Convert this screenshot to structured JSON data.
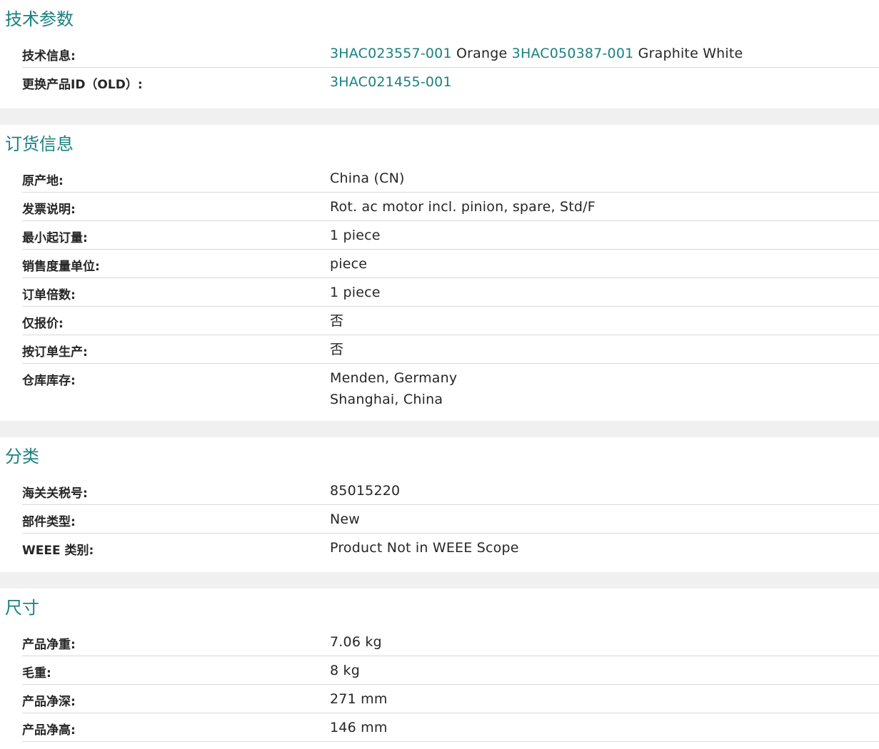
{
  "tech": {
    "title": "技术参数",
    "tech_info_label": "技术信息:",
    "tech_info": [
      {
        "text": "3HAC023557-001",
        "link": true
      },
      {
        "text": " Orange ",
        "link": false
      },
      {
        "text": "3HAC050387-001",
        "link": true
      },
      {
        "text": " Graphite White",
        "link": false
      }
    ],
    "replace_label": "更换产品ID（OLD）:",
    "replace_value": "3HAC021455-001"
  },
  "order": {
    "title": "订货信息",
    "rows": [
      {
        "label": "原产地:",
        "value": "China (CN)"
      },
      {
        "label": "发票说明:",
        "value": "Rot. ac motor incl. pinion, spare, Std/F"
      },
      {
        "label": "最小起订量:",
        "value": "1 piece"
      },
      {
        "label": "销售度量单位:",
        "value": "piece"
      },
      {
        "label": "订单倍数:",
        "value": "1 piece"
      },
      {
        "label": "仅报价:",
        "value": "否"
      },
      {
        "label": "按订单生产:",
        "value": "否"
      }
    ],
    "warehouse_label": "仓库库存:",
    "warehouses": [
      "Menden, Germany",
      "Shanghai, China"
    ]
  },
  "classification": {
    "title": "分类",
    "rows": [
      {
        "label": "海关关税号:",
        "value": "85015220"
      },
      {
        "label": "部件类型:",
        "value": "New"
      },
      {
        "label": "WEEE 类别:",
        "value": "Product Not in WEEE Scope"
      }
    ]
  },
  "dimensions": {
    "title": "尺寸",
    "rows": [
      {
        "label": "产品净重:",
        "value": "7.06 kg"
      },
      {
        "label": "毛重:",
        "value": "8 kg"
      },
      {
        "label": "产品净深:",
        "value": "271 mm"
      },
      {
        "label": "产品净高:",
        "value": "146 mm"
      }
    ]
  },
  "colors": {
    "accent": "#1a8080",
    "text": "#262626",
    "divider": "#d9d9d9",
    "gap": "#f0f0f0"
  }
}
